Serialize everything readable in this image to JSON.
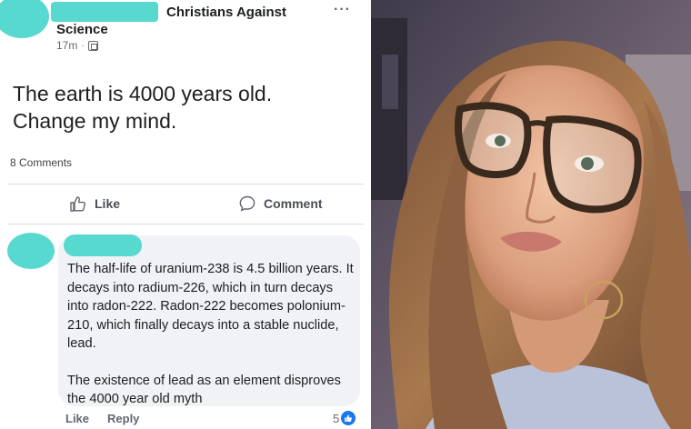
{
  "post": {
    "group_name_line1": "Christians Against",
    "group_name_line2": "Science",
    "time": "17m",
    "dot": "·",
    "text_line1": "The earth is 4000 years old.",
    "text_line2": "Change my mind.",
    "comments_count": "8 Comments",
    "more": "···"
  },
  "actions": {
    "like_label": "Like",
    "comment_label": "Comment"
  },
  "comment": {
    "paragraph1": "The half-life of uranium-238 is 4.5 billion years. It decays into radium-226, which in turn decays into radon-222. Radon-222 becomes polonium-210, which finally decays into a stable nuclide, lead.",
    "paragraph2": "The existence of lead as an element disproves the 4000 year old myth",
    "like_label": "Like",
    "reply_label": "Reply",
    "reaction_count": "5"
  },
  "colors": {
    "redaction": "#58d9cf",
    "bubble": "#f0f2f5",
    "reaction_blue": "#1877f2"
  },
  "icons": [
    "thumbs-up-icon",
    "comment-icon",
    "globe-icon",
    "more-options-icon",
    "like-reaction-icon"
  ]
}
